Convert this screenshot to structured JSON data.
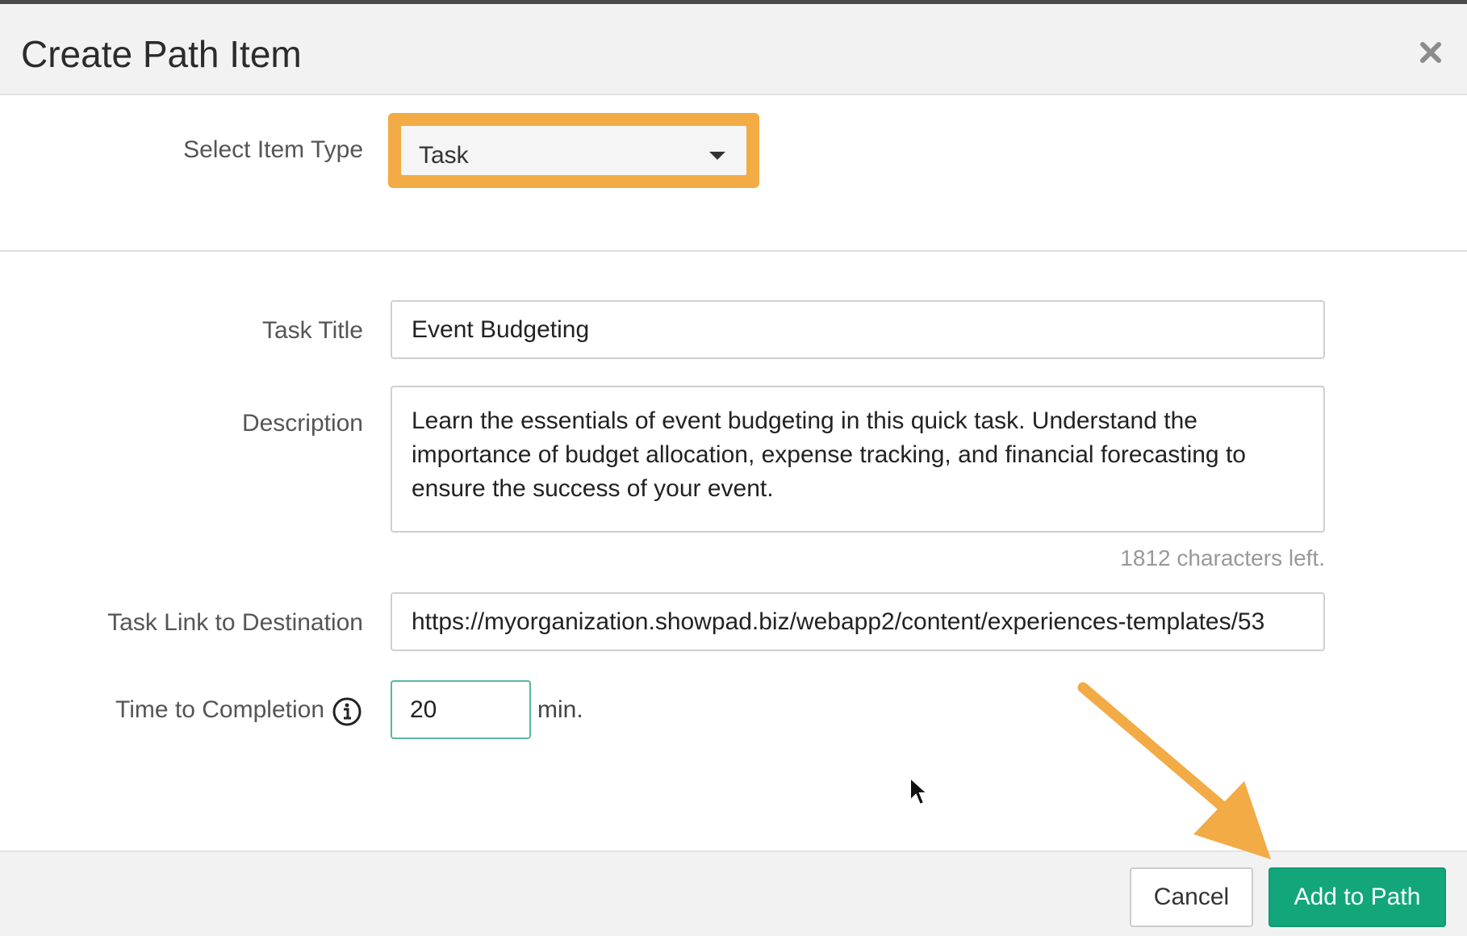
{
  "dialog": {
    "title": "Create Path Item",
    "close_icon": "close-icon"
  },
  "item_type": {
    "label": "Select Item Type",
    "selected": "Task",
    "highlight_color": "#f2ab45"
  },
  "task_title": {
    "label": "Task Title",
    "value": "Event Budgeting"
  },
  "description": {
    "label": "Description",
    "value": "Learn the essentials of event budgeting in this quick task. Understand the importance of budget allocation, expense tracking, and financial forecasting to ensure the success of your event.",
    "chars_left": "1812 characters left."
  },
  "task_link": {
    "label": "Task Link to Destination",
    "value": "https://myorganization.showpad.biz/webapp2/content/experiences-templates/53"
  },
  "time_to_completion": {
    "label": "Time to Completion",
    "info_icon": "info-icon",
    "value": "20",
    "unit": "min."
  },
  "footer": {
    "cancel_label": "Cancel",
    "add_label": "Add to Path",
    "primary_color": "#13a67b"
  },
  "annotation": {
    "arrow_color": "#f2ab45"
  }
}
